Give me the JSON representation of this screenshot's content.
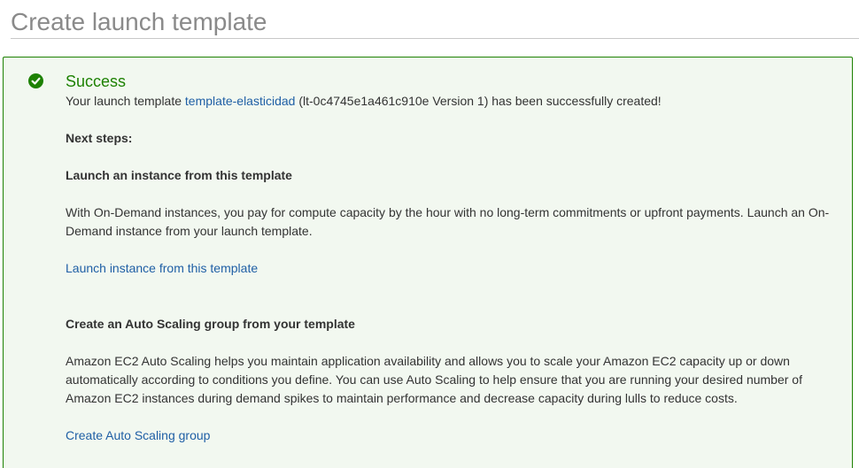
{
  "page": {
    "title": "Create launch template"
  },
  "success": {
    "heading": "Success",
    "msg_prefix": "Your launch template ",
    "template_name": "template-elasticidad",
    "msg_suffix": " (lt-0c4745e1a461c910e Version 1) has been successfully created!",
    "next_steps": "Next steps:",
    "launch": {
      "title": "Launch an instance from this template",
      "text": "With On-Demand instances, you pay for compute capacity by the hour with no long-term commitments or upfront payments. Launch an On-Demand instance from your launch template.",
      "link": "Launch instance from this template"
    },
    "autoscaling": {
      "title": "Create an Auto Scaling group from your template",
      "text": "Amazon EC2 Auto Scaling helps you maintain application availability and allows you to scale your Amazon EC2 capacity up or down automatically according to conditions you define. You can use Auto Scaling to help ensure that you are running your desired number of Amazon EC2 instances during demand spikes to maintain performance and decrease capacity during lulls to reduce costs.",
      "link": "Create Auto Scaling group"
    }
  },
  "icons": {
    "status": "check-circle-icon"
  },
  "colors": {
    "success_green": "#1d8102",
    "panel_bg": "#f2f8f0",
    "link_blue": "#1f5fa5",
    "title_gray": "#8a8a8a"
  }
}
